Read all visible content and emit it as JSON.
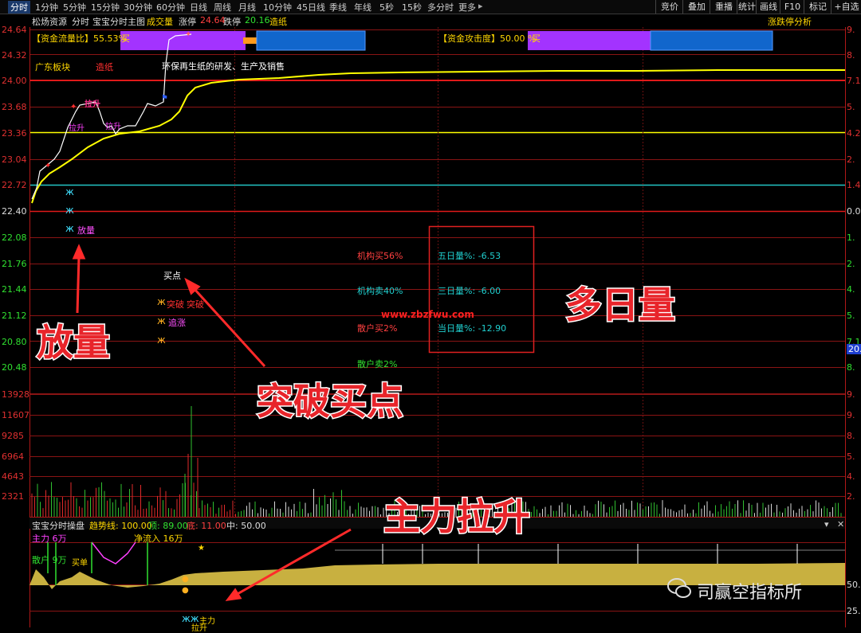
{
  "toolbar": {
    "tabs": [
      "分时",
      "1分钟",
      "5分钟",
      "15分钟",
      "30分钟",
      "60分钟",
      "日线",
      "周线",
      "月线",
      "10分钟",
      "45日线",
      "季线",
      "年线",
      "5秒",
      "15秒",
      "多分时",
      "更多"
    ],
    "right_buttons": [
      "竞价",
      "叠加",
      "重播",
      "统计",
      "画线",
      "F10",
      "标记",
      "+自选"
    ]
  },
  "infobar": {
    "stock_name": "松炀资源",
    "mode": "分时",
    "indicator_name": "宝宝分时主图",
    "volume_label": "成交量",
    "limit_up_label": "涨停",
    "limit_up_value": "24.64",
    "limit_down_label": "跌停",
    "limit_down_value": "20.16",
    "concept": "造纸",
    "right_link": "涨跌停分析"
  },
  "price_axis": {
    "left": [
      "24.64",
      "24.32",
      "24.00",
      "23.68",
      "23.36",
      "23.04",
      "22.72",
      "22.40",
      "22.08",
      "21.76",
      "21.44",
      "21.12",
      "20.80",
      "20.48"
    ],
    "right": [
      "9.",
      "8.",
      "7.1",
      "5.",
      "4.2",
      "2.",
      "1.4",
      "0.0",
      "1.",
      "2.",
      "4.",
      "5.",
      "7.1",
      "8."
    ],
    "right_marker": "20.6"
  },
  "volume_axis": {
    "left": [
      "13928",
      "11607",
      "9285",
      "6964",
      "4643",
      "2321"
    ],
    "right": [
      "9.",
      "9.",
      "8.",
      "5.",
      "4.",
      "2."
    ]
  },
  "fund_bars": {
    "left_label": "【资金流量比】55.53%",
    "left_tag": "买",
    "right_label": "【资金攻击度】50.00 %",
    "right_tag": "买"
  },
  "annotations": {
    "sector": "广东板块",
    "sector_tag": "造纸",
    "business": "环保再生纸的研发、生产及销售",
    "buy_point": "买点",
    "breakout1": "突破",
    "breakout2": "突破",
    "chase": "追涨",
    "volume_up": "放量",
    "pull_up_1": "拉升",
    "pull_up_2": "拉升",
    "pull_up_3": "拉升",
    "watermark": "www.zbzfwu.com"
  },
  "flow": {
    "inst_buy": "机构买56%",
    "inst_sell": "机构卖40%",
    "retail_buy": "散户买2%",
    "retail_sell": "散户卖2%"
  },
  "multi_day": {
    "five_day": "五日量%: -6.53",
    "three_day": "三日量%: -6.00",
    "today": "当日量%: -12.90"
  },
  "overlay": {
    "volume_up": "放量",
    "breakout_buy": "突破买点",
    "multi_day_volume": "多日量",
    "main_force": "主力拉升"
  },
  "sub_chart": {
    "title": "宝宝分时操盘",
    "trend_label": "趋势线: 100.00",
    "top_label": "顶: 89.00",
    "bottom_label": "底: 11.00",
    "mid_label": "中: 50.00",
    "main_force": "主力 6万",
    "retail": "散户 9万",
    "net_inflow": "净流入 16万",
    "signal_buy": "买单",
    "pull_up": "主力",
    "pull_up_2": "拉升",
    "right_labels": [
      "50.",
      "25."
    ]
  },
  "brand": {
    "text": "司赢空指标所"
  },
  "colors": {
    "price_line": "#ffffff",
    "avg_line": "#ffff00",
    "red_grid": "#b01818",
    "yellow_line": "#ffff00",
    "cyan_line": "#23c5c5",
    "purple_bar": "#a333ff",
    "blue_bar": "#1166cc",
    "gold_area": "#c8b040"
  }
}
